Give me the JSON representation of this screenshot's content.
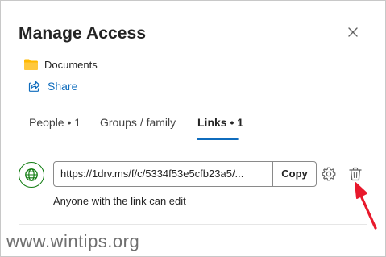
{
  "dialog": {
    "title": "Manage Access",
    "close_icon": "close-icon"
  },
  "item": {
    "icon": "folder-icon",
    "name": "Documents"
  },
  "share": {
    "icon": "share-icon",
    "label": "Share"
  },
  "tabs": [
    {
      "label": "People • 1",
      "active": false
    },
    {
      "label": "Groups / family",
      "active": false
    },
    {
      "label": "Links • 1",
      "active": true
    }
  ],
  "link": {
    "icon": "globe-icon",
    "url": "https://1drv.ms/f/c/5334f53e5cfb23a5/...",
    "copy_label": "Copy",
    "settings_icon": "gear-icon",
    "delete_icon": "trash-icon",
    "permission_text": "Anyone with the link can edit"
  },
  "annotation": {
    "arrow_color": "#e8192c"
  },
  "watermark": "www.wintips.org",
  "colors": {
    "accent": "#0f6cbd",
    "globe": "#107c10",
    "folder": "#ffb900"
  }
}
